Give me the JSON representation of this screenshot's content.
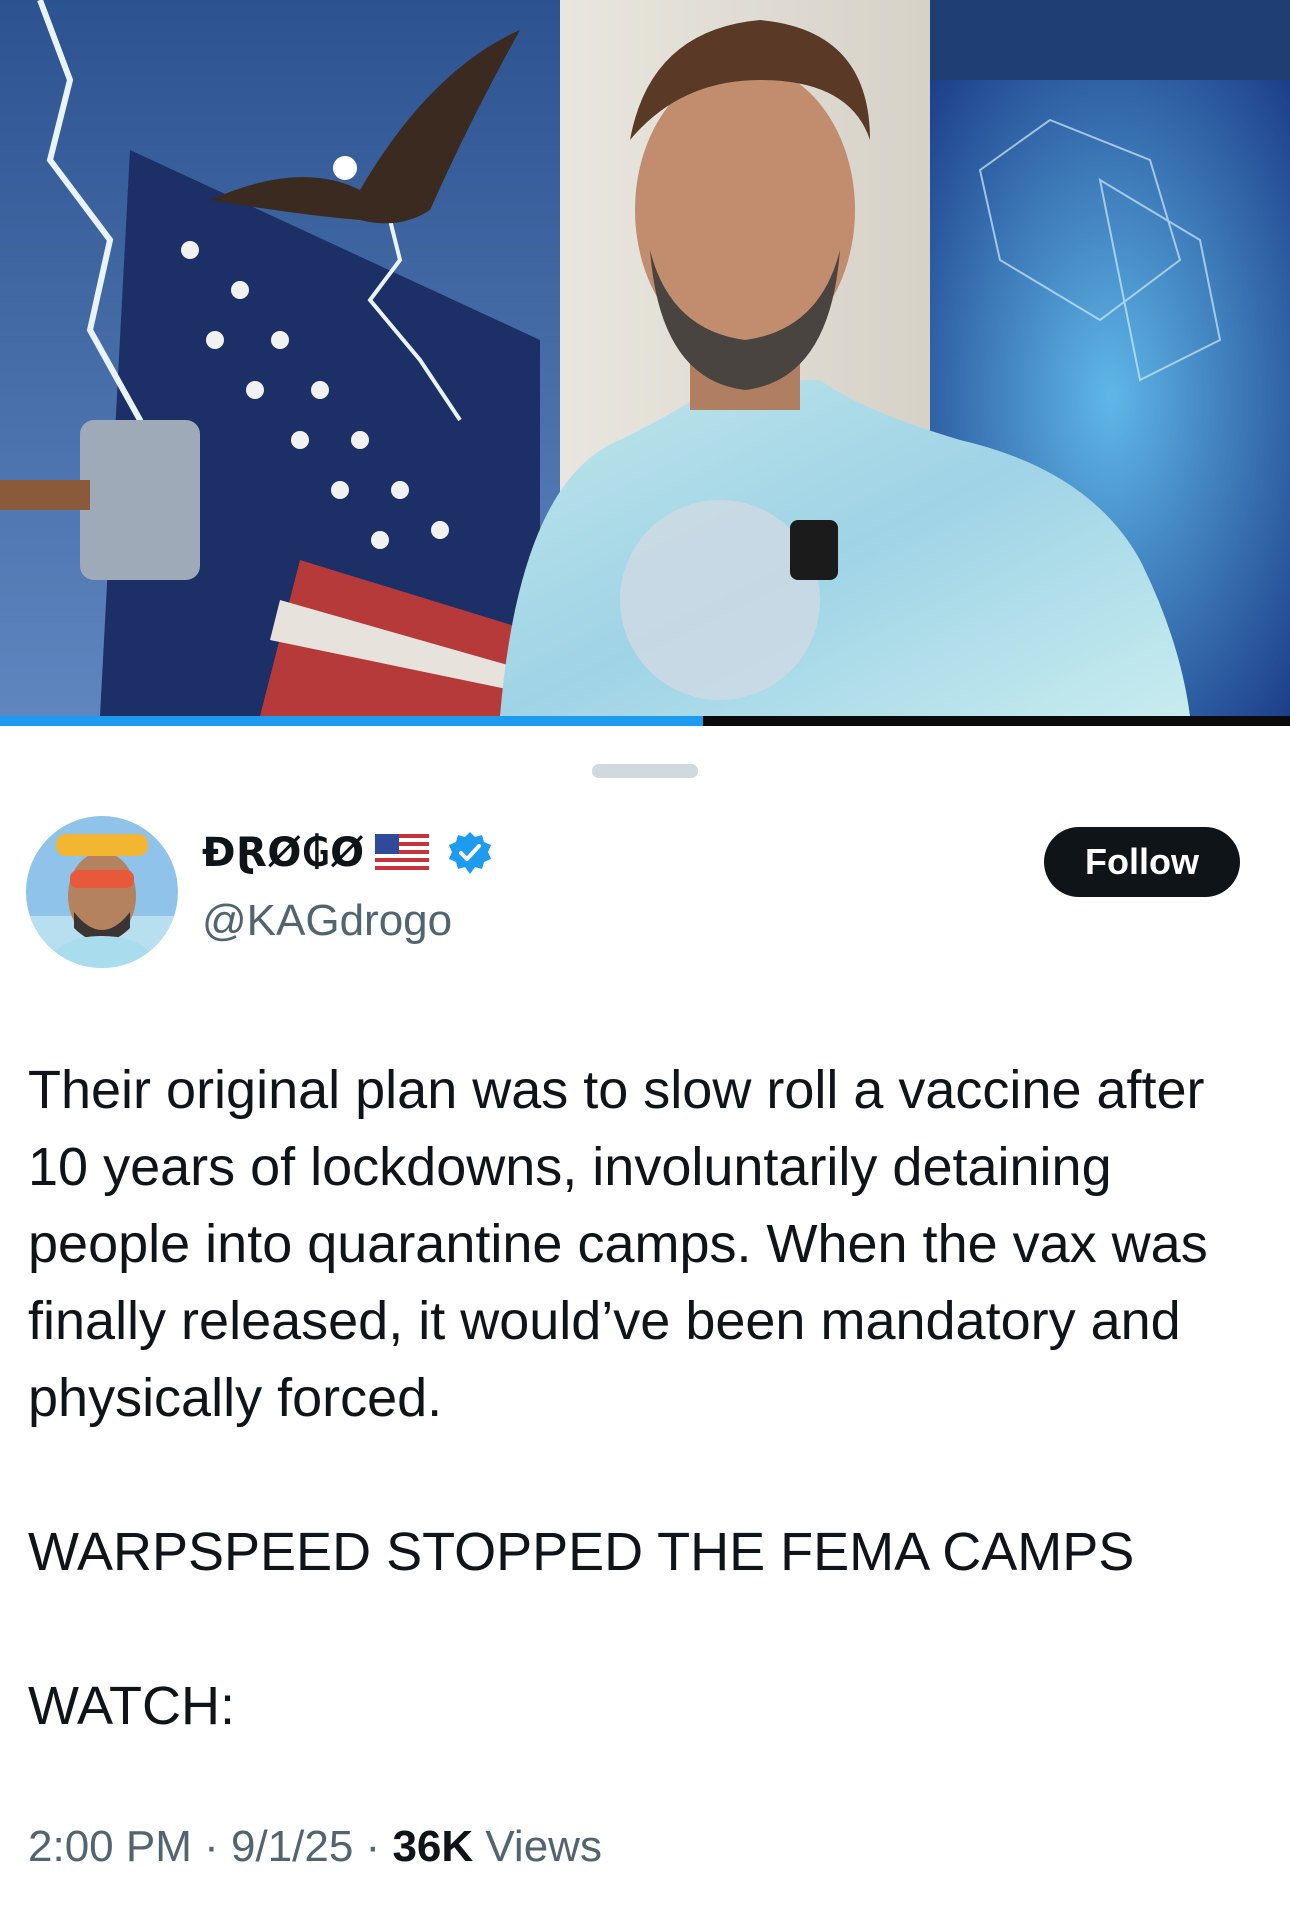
{
  "video": {
    "progress": 0.545
  },
  "user": {
    "display_name": "ĐⱤØ₲Ø",
    "flag_icon": "us-flag-icon",
    "verified_icon": "verified-badge-icon",
    "handle": "@KAGdrogo"
  },
  "follow_label": "Follow",
  "tweet": {
    "paragraphs": [
      "Their original plan was to slow roll a vaccine after 10 years of lockdowns, involuntarily detaining people into quarantine camps. When the vax was finally released, it would’ve been mandatory and physically forced.",
      "WARPSPEED STOPPED THE FEMA CAMPS",
      "WATCH:"
    ]
  },
  "meta": {
    "time": "2:00 PM",
    "sep1": " · ",
    "date": "9/1/25",
    "sep2": " · ",
    "views_count": "36K",
    "views_label": " Views"
  },
  "colors": {
    "accent": "#1d9bf0",
    "text": "#0f1419",
    "secondary": "#536471"
  }
}
